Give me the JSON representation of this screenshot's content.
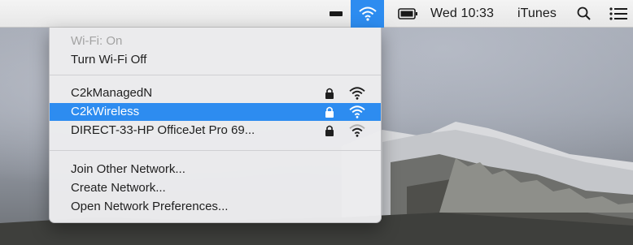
{
  "menubar": {
    "clock": "Wed 10:33",
    "app_item": "iTunes"
  },
  "wifi_menu": {
    "status": "Wi-Fi: On",
    "toggle_label": "Turn Wi-Fi Off",
    "networks": [
      {
        "name": "C2kManagedN",
        "locked": true,
        "selected": false
      },
      {
        "name": "C2kWireless",
        "locked": true,
        "selected": true
      },
      {
        "name": "DIRECT-33-HP OfficeJet Pro 69...",
        "locked": true,
        "selected": false
      }
    ],
    "join_other": "Join Other Network...",
    "create_network": "Create Network...",
    "open_preferences": "Open Network Preferences..."
  },
  "colors": {
    "accent": "#2d8cf0",
    "menubar_bg": "#ececec"
  }
}
